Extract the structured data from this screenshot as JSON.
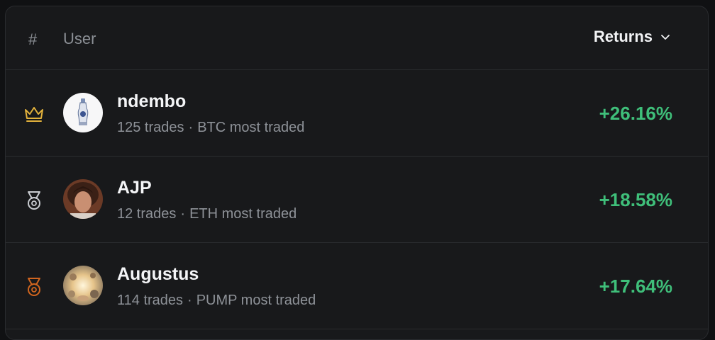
{
  "header": {
    "rank_label": "#",
    "user_label": "User",
    "returns_label": "Returns",
    "sort_icon": "chevron-down-icon"
  },
  "colors": {
    "positive": "#3fbf7a",
    "gold": "#e3b23c",
    "silver": "#c9ccd1",
    "bronze": "#d0651f"
  },
  "rows": [
    {
      "rank_icon": "crown-icon",
      "name": "ndembo",
      "trades": "125 trades",
      "separator": "·",
      "most_traded": "BTC most traded",
      "returns": "+26.16%"
    },
    {
      "rank_icon": "silver-medal-icon",
      "name": "AJP",
      "trades": "12 trades",
      "separator": "·",
      "most_traded": "ETH most traded",
      "returns": "+18.58%"
    },
    {
      "rank_icon": "bronze-medal-icon",
      "name": "Augustus",
      "trades": "114 trades",
      "separator": "·",
      "most_traded": "PUMP most traded",
      "returns": "+17.64%"
    }
  ]
}
